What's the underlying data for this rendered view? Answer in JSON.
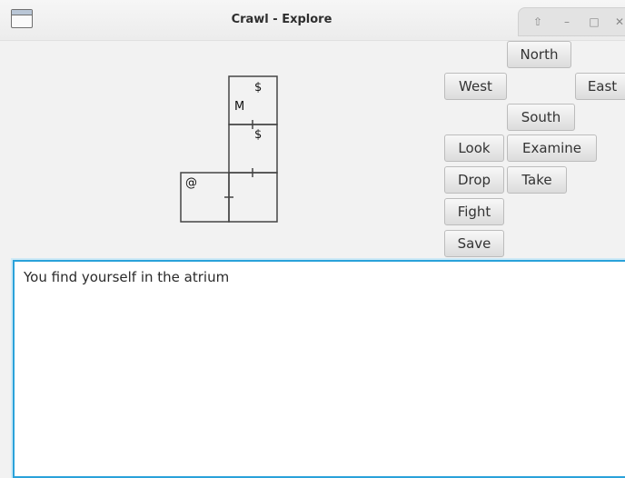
{
  "window": {
    "title": "Crawl - Explore",
    "controls": [
      "restore-icon",
      "minimize-icon",
      "maximize-icon",
      "close-icon"
    ]
  },
  "map": {
    "rooms": [
      {
        "col": 1,
        "row": 0,
        "labels": [
          "$",
          "M"
        ]
      },
      {
        "col": 1,
        "row": 1,
        "labels": [
          "$"
        ]
      },
      {
        "col": 1,
        "row": 2,
        "labels": []
      },
      {
        "col": 0,
        "row": 2,
        "labels": [
          "@"
        ]
      }
    ],
    "doors": [
      {
        "between": "room-0-room-1",
        "orientation": "vertical"
      },
      {
        "between": "room-1-room-2",
        "orientation": "vertical"
      },
      {
        "between": "room-2-room-3",
        "orientation": "horizontal"
      }
    ]
  },
  "buttons": {
    "north": "North",
    "west": "West",
    "east": "East",
    "south": "South",
    "look": "Look",
    "examine": "Examine",
    "drop": "Drop",
    "take": "Take",
    "fight": "Fight",
    "save": "Save"
  },
  "output": {
    "text": "You find yourself in the atrium"
  }
}
